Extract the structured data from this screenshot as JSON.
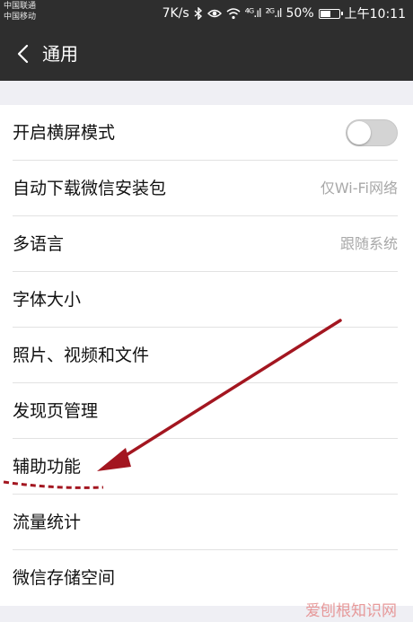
{
  "status_bar": {
    "carrier_1": "中国联通",
    "carrier_2": "中国移动",
    "speed": "7K/s",
    "signal_1": "⁴ᴳ.ıl",
    "signal_2": "²ᴳ.ıl",
    "battery_percent": "50%",
    "battery_level": 0.5,
    "time": "上午10:11"
  },
  "nav": {
    "title": "通用"
  },
  "settings": [
    {
      "label": "开启横屏模式",
      "toggle_on": false
    },
    {
      "label": "自动下载微信安装包",
      "value": "仅Wi-Fi网络"
    },
    {
      "label": "多语言",
      "value": "跟随系统"
    },
    {
      "label": "字体大小"
    },
    {
      "label": "照片、视频和文件"
    },
    {
      "label": "发现页管理"
    },
    {
      "label": "辅助功能"
    },
    {
      "label": "流量统计"
    },
    {
      "label": "微信存储空间"
    }
  ],
  "annotation_color": "#a31620",
  "watermark": "爱刨根知识网"
}
